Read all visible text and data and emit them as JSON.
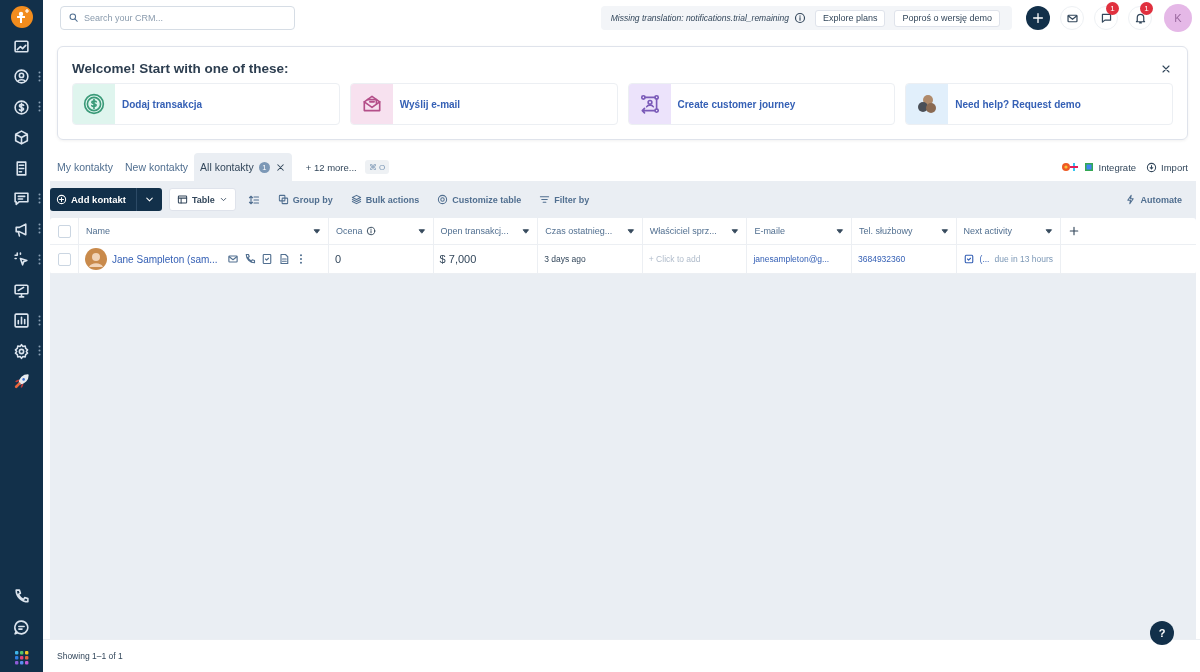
{
  "sidebar": {
    "items": [
      {
        "kind": "dashboard",
        "menu": false
      },
      {
        "kind": "contacts",
        "menu": true
      },
      {
        "kind": "deals",
        "menu": true
      },
      {
        "kind": "products",
        "menu": false
      },
      {
        "kind": "document",
        "menu": false
      },
      {
        "kind": "chat",
        "menu": true
      },
      {
        "kind": "megaphone",
        "menu": true
      },
      {
        "kind": "cursor",
        "menu": true
      },
      {
        "kind": "monitor",
        "menu": false
      },
      {
        "kind": "chart",
        "menu": true
      },
      {
        "kind": "settings",
        "menu": true
      },
      {
        "kind": "rocket",
        "menu": false
      }
    ],
    "bottom": [
      {
        "kind": "phone"
      },
      {
        "kind": "message"
      },
      {
        "kind": "apps"
      }
    ]
  },
  "search": {
    "placeholder": "Search your CRM..."
  },
  "trial_banner": {
    "text": "Missing translation: notifications.trial_remaining",
    "buttons": [
      "Explore plans",
      "Poproś o wersję demo"
    ]
  },
  "header": {
    "badges": [
      {
        "kind": "mail"
      },
      {
        "kind": "chat",
        "count": "1"
      },
      {
        "kind": "bell",
        "count": "1"
      }
    ],
    "avatar": "K"
  },
  "welcome": {
    "title": "Welcome! Start with one of these:",
    "actions": [
      {
        "kind": "deal",
        "label": "Dodaj transakcja"
      },
      {
        "kind": "email",
        "label": "Wyślij e-mail"
      },
      {
        "kind": "journey",
        "label": "Create customer journey"
      },
      {
        "kind": "demo",
        "label": "Need help? Request demo"
      }
    ]
  },
  "views": {
    "tabs": [
      {
        "label": "My kontakty",
        "selected": false
      },
      {
        "label": "New kontakty",
        "selected": false
      },
      {
        "label": "All kontakty",
        "selected": true,
        "count": "1"
      }
    ],
    "more": "+ 12 more...",
    "shortcut": "⌘ O",
    "integrate": "Integrate",
    "import": "Import"
  },
  "toolbar": {
    "add": "Add kontakt",
    "view": "Table",
    "actions": [
      {
        "kind": "group",
        "label": "Group by"
      },
      {
        "kind": "bulk",
        "label": "Bulk actions"
      },
      {
        "kind": "customize",
        "label": "Customize table"
      },
      {
        "kind": "filter",
        "label": "Filter by"
      }
    ],
    "automate": "Automate"
  },
  "table": {
    "select_all_checked": false,
    "columns": [
      {
        "label": "Name",
        "info": false
      },
      {
        "label": "Ocena",
        "info": true
      },
      {
        "label": "Open transakcj...",
        "info": false
      },
      {
        "label": "Czas ostatnieg...",
        "info": false
      },
      {
        "label": "Właściciel sprz...",
        "info": false
      },
      {
        "label": "E-maile",
        "info": false
      },
      {
        "label": "Tel. służbowy",
        "info": false
      },
      {
        "label": "Next activity",
        "info": false
      }
    ],
    "rows": [
      {
        "checked": false,
        "cells": [
          {
            "kind": "name",
            "text": "Jane Sampleton (sam..."
          },
          {
            "kind": "big",
            "text": "0"
          },
          {
            "kind": "big",
            "text": "$ 7,000"
          },
          {
            "kind": "small",
            "text": "3 days ago"
          },
          {
            "kind": "placeholder",
            "text": "+ Click to add"
          },
          {
            "kind": "link",
            "text": "janesampleton@g..."
          },
          {
            "kind": "link",
            "text": "3684932360"
          },
          {
            "kind": "activity",
            "text": "(...",
            "due": "due in 13 hours"
          }
        ]
      }
    ]
  },
  "footer": {
    "text": "Showing 1–1 of 1"
  },
  "help": "?"
}
